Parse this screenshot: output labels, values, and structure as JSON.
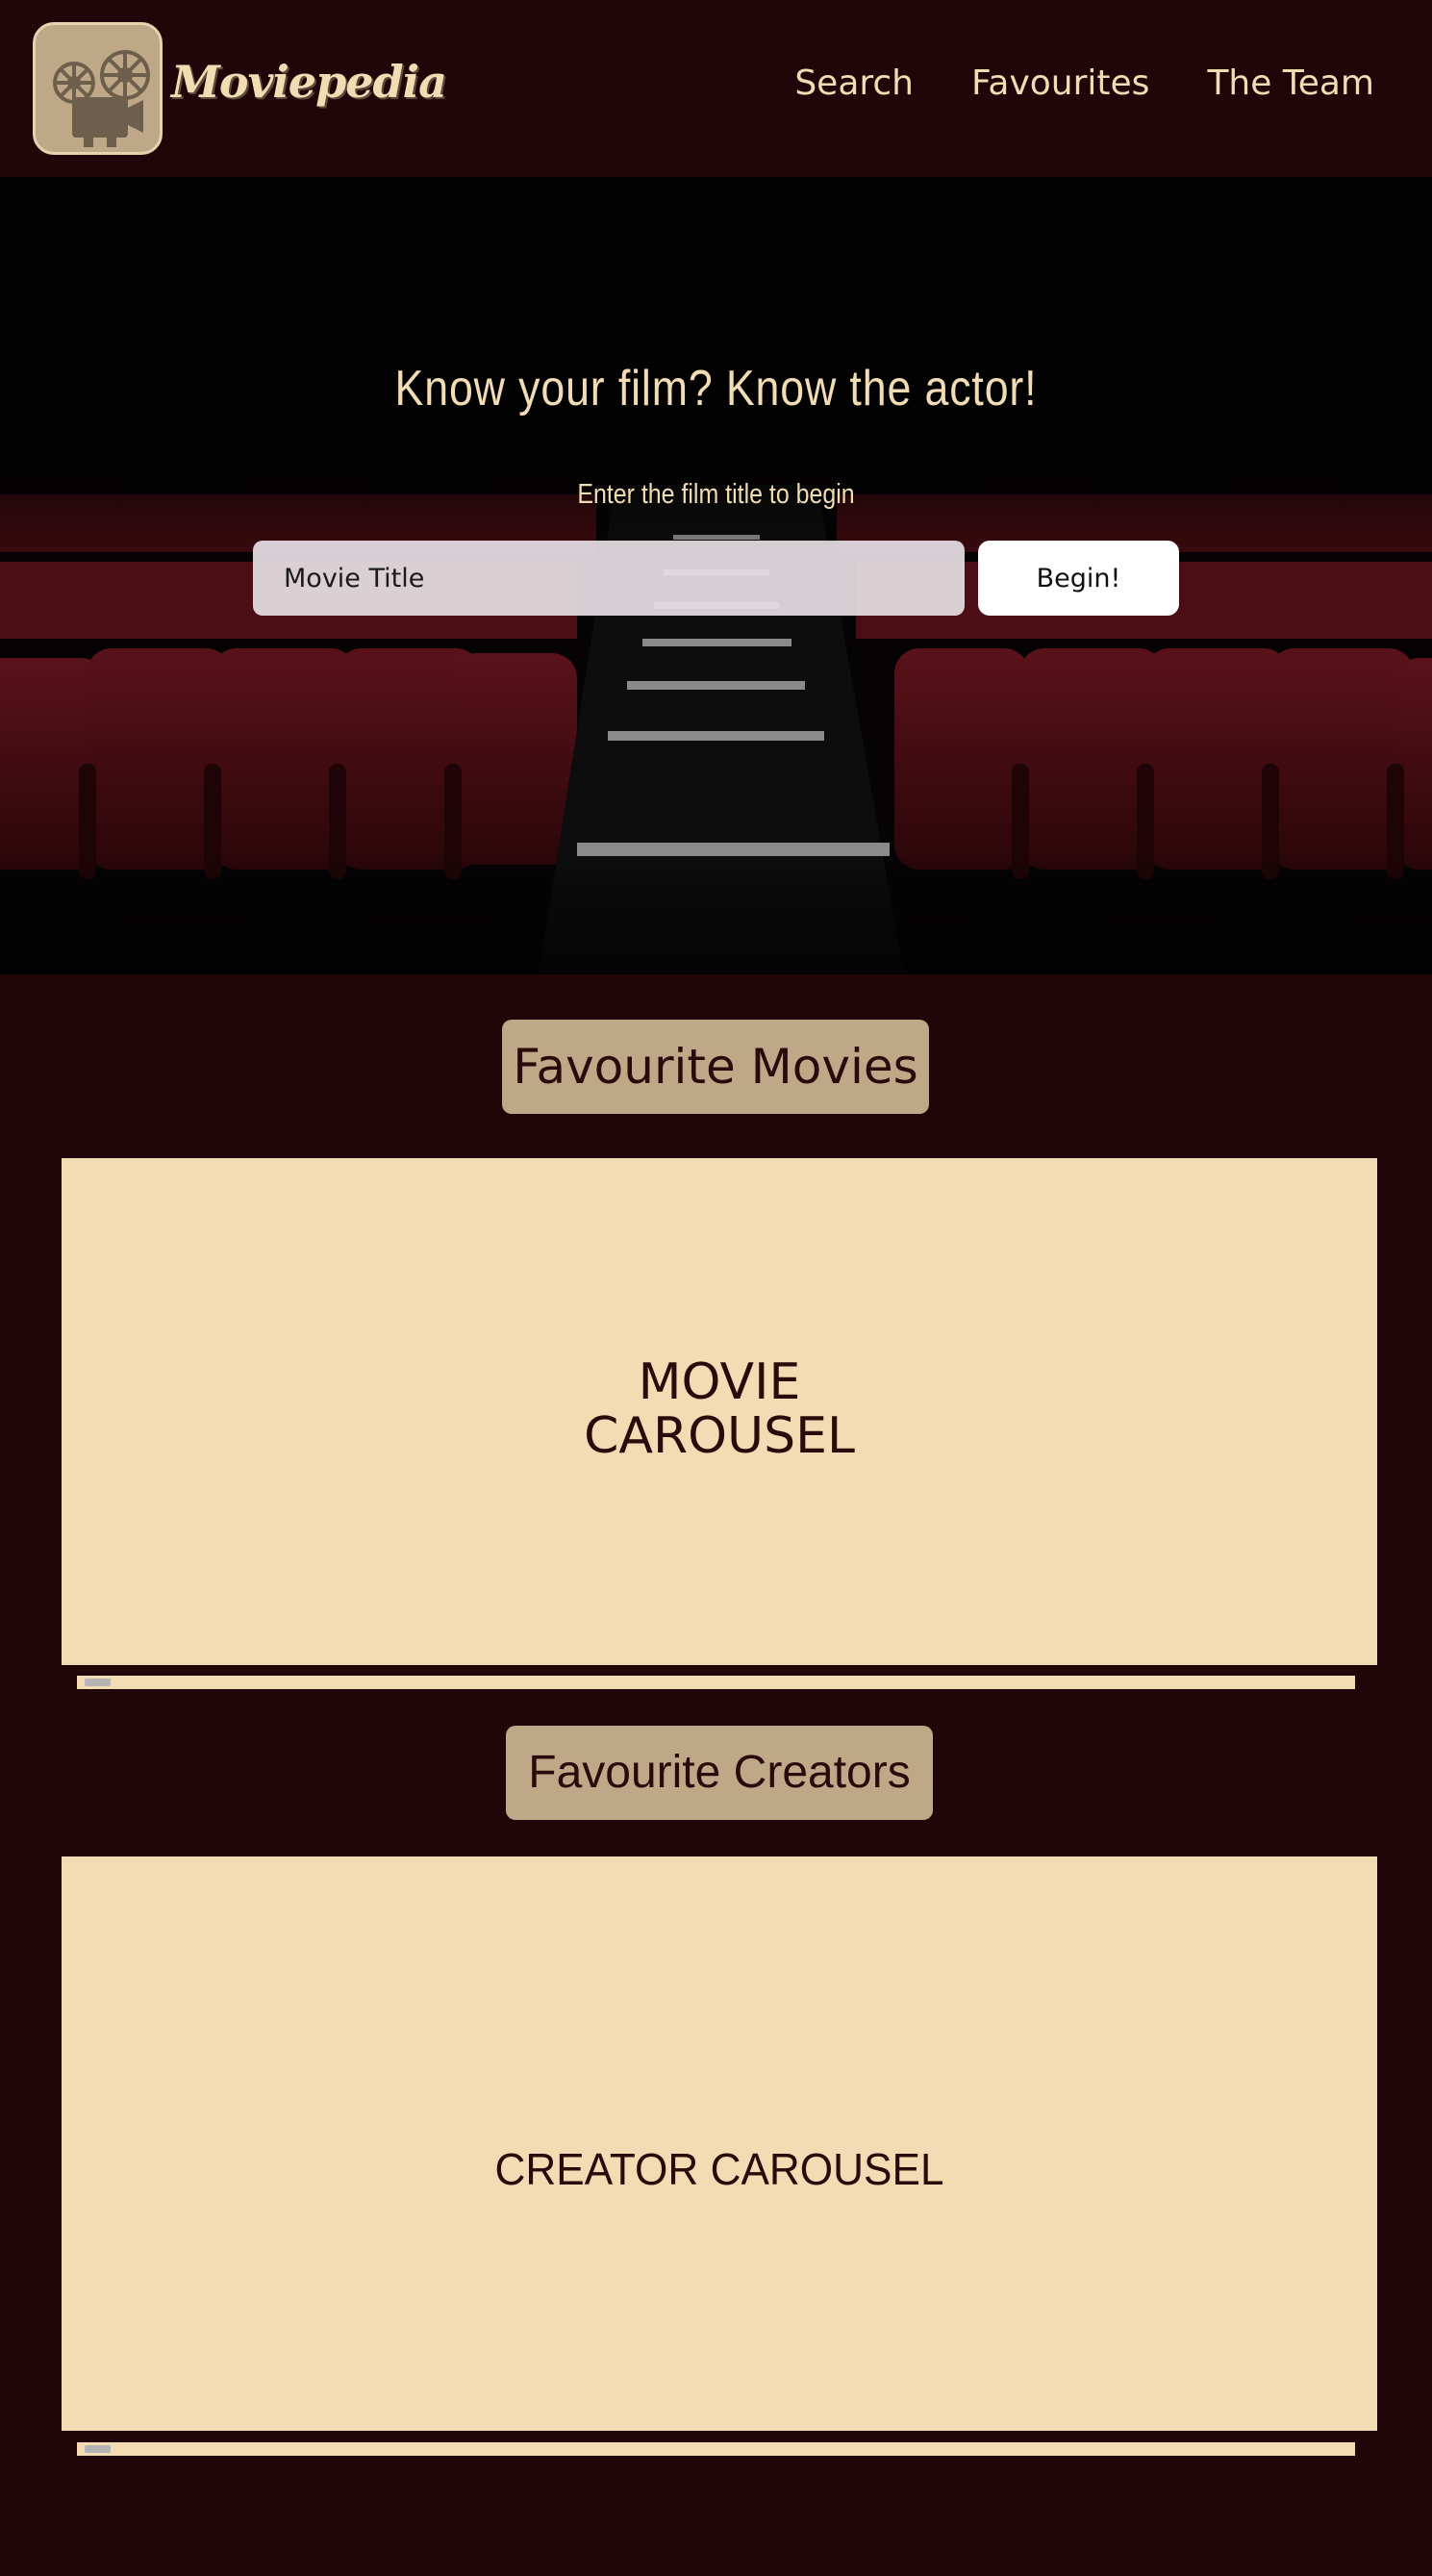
{
  "nav": {
    "brand": "Moviepedia",
    "links": [
      "Search",
      "Favourites",
      "The Team"
    ]
  },
  "hero": {
    "title": "Know your film? Know the actor!",
    "subtitle": "Enter the film title to begin",
    "search_placeholder": "Movie Title",
    "begin_label": "Begin!"
  },
  "movies": {
    "heading": "Favourite Movies",
    "carousel_label": "MOVIE\nCAROUSEL"
  },
  "creators": {
    "heading": "Favourite Creators",
    "carousel_label": "CREATOR CAROUSEL"
  },
  "colors": {
    "background": "#200608",
    "accent_text": "#f2dcb3",
    "heading_bg": "#bfa888",
    "carousel_bg": "#f3dcb3",
    "seat_red": "#4a0d12"
  },
  "icons": {
    "logo": "film-projector-icon"
  }
}
